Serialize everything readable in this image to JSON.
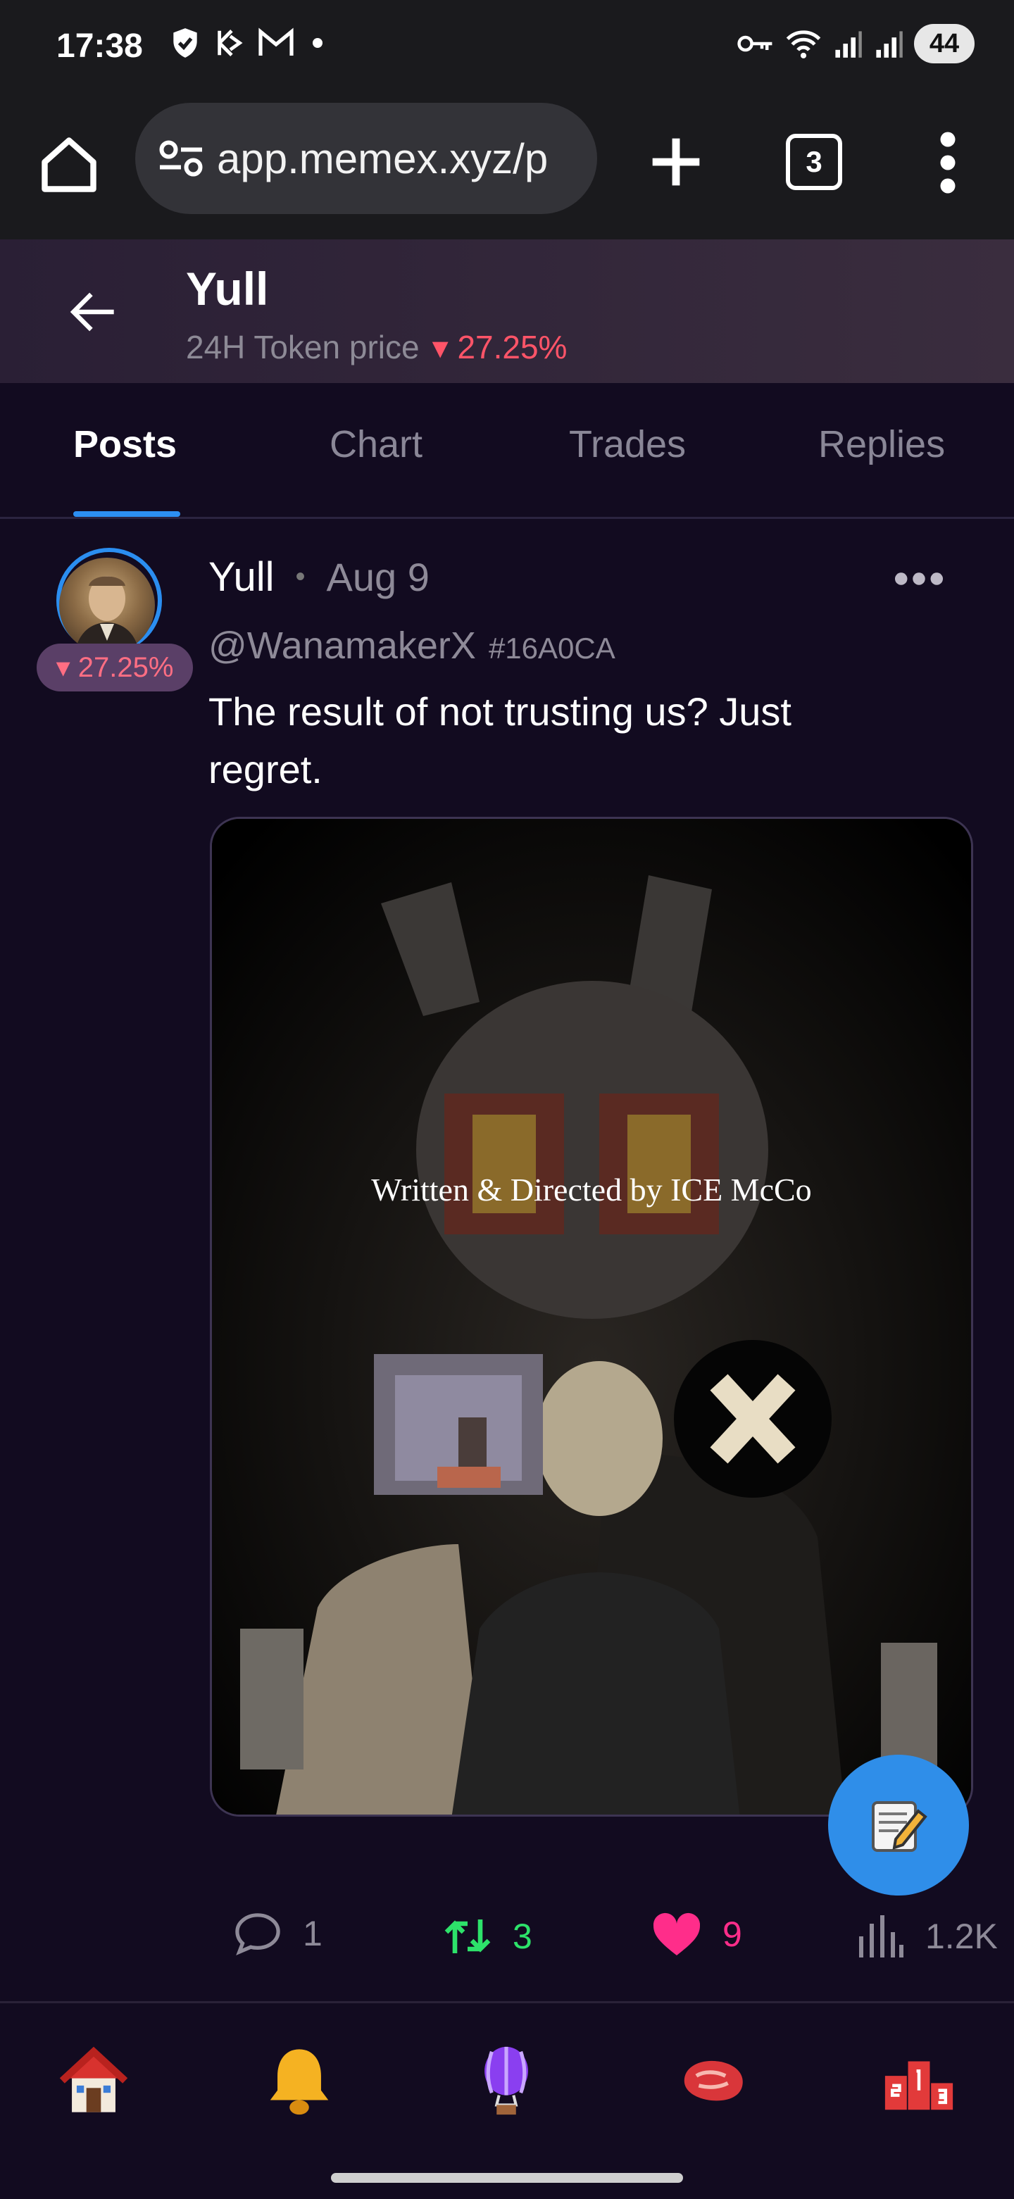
{
  "status_bar": {
    "time": "17:38",
    "battery": "44"
  },
  "browser": {
    "url": "app.memex.xyz/p",
    "tab_count": "3"
  },
  "header": {
    "title": "Yull",
    "subtitle": "24H Token price",
    "change": "▾ 27.25%"
  },
  "tabs": [
    {
      "label": "Posts"
    },
    {
      "label": "Chart"
    },
    {
      "label": "Trades"
    },
    {
      "label": "Replies"
    }
  ],
  "post": {
    "author": "Yull",
    "separator": "•",
    "date": "Aug 9",
    "handle": "@WanamakerX",
    "tag": "#16A0CA",
    "avatar_change": "▾ 27.25%",
    "text": "The result of not trusting us? Just regret.",
    "image_caption": "Written & Directed by ICE McCo",
    "comments": "1",
    "reposts": "3",
    "likes": "9",
    "views": "1.2K"
  },
  "colors": {
    "accent": "#2c8ff2",
    "down": "#ff5468",
    "repost": "#2de26a",
    "like": "#ff2d8a",
    "background": "#120b20"
  },
  "bottom_nav_icons": [
    "home-icon",
    "bell-icon",
    "balloon-icon",
    "steak-icon",
    "podium-icon"
  ]
}
